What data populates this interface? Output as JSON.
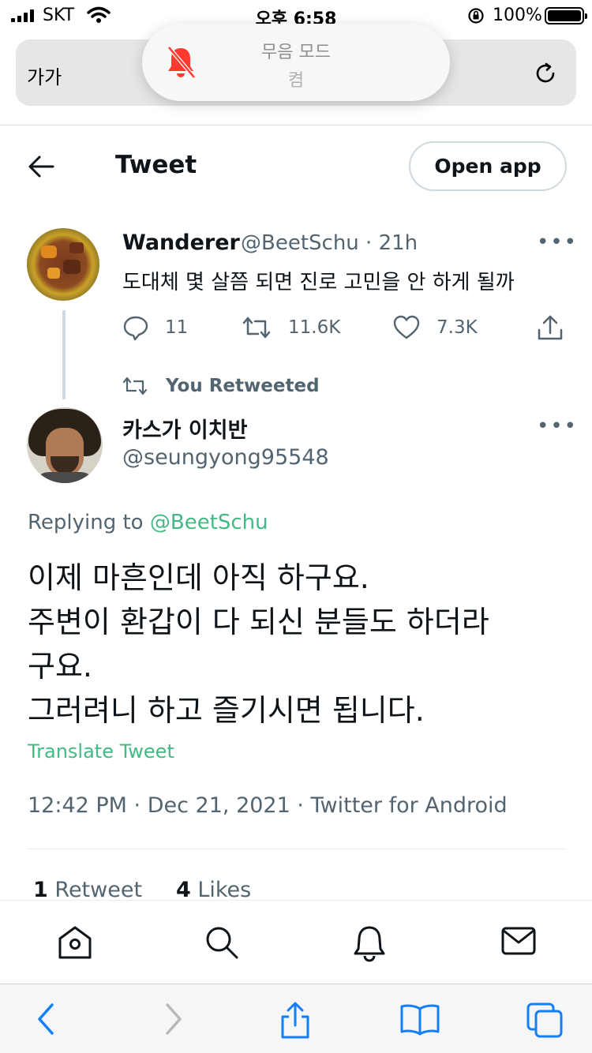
{
  "status_bar": {
    "carrier": "SKT",
    "time": "오후 6:58",
    "battery_percent": "100%",
    "battery_level": 1.0
  },
  "browser": {
    "text_size_label": "가가",
    "silent_toast": {
      "title": "무음 모드",
      "subtitle": "켬"
    }
  },
  "header": {
    "title": "Tweet",
    "open_app_label": "Open app"
  },
  "original_tweet": {
    "display_name": "Wanderer",
    "handle_time": "@BeetSchu · 21h",
    "text": "도대체 몇 살쯤 되면 진로 고민을 안 하게 될까",
    "replies": "11",
    "retweets": "11.6K",
    "likes": "7.3K",
    "more": "•••"
  },
  "retweet_banner": "You Retweeted",
  "reply_tweet": {
    "display_name": "카스가 이치반",
    "handle": "@seungyong95548",
    "more": "•••",
    "replying_prefix": "Replying to",
    "replying_to": "@BeetSchu",
    "lines": [
      "이제 마흔인데 아직 하구요.",
      "주변이 환갑이 다 되신 분들도 하더라",
      "구요.",
      "그러려니 하고 즐기시면 됩니다."
    ],
    "translate_label": "Translate Tweet",
    "meta": "12:42 PM · Dec 21, 2021 · Twitter for Android",
    "retweet_count": "1",
    "retweet_label": "Retweet",
    "like_count": "4",
    "like_label": "Likes"
  },
  "icons": {
    "twitter_nav": [
      "home-icon",
      "search-icon",
      "notifications-icon",
      "messages-icon"
    ],
    "safari_toolbar": [
      "back-icon",
      "forward-icon",
      "share-icon",
      "bookmarks-icon",
      "tabs-icon"
    ]
  },
  "colors": {
    "link_green": "#42b983",
    "muted_text": "#536471",
    "safari_blue": "#147efb",
    "silent_red": "#ff3b30"
  }
}
